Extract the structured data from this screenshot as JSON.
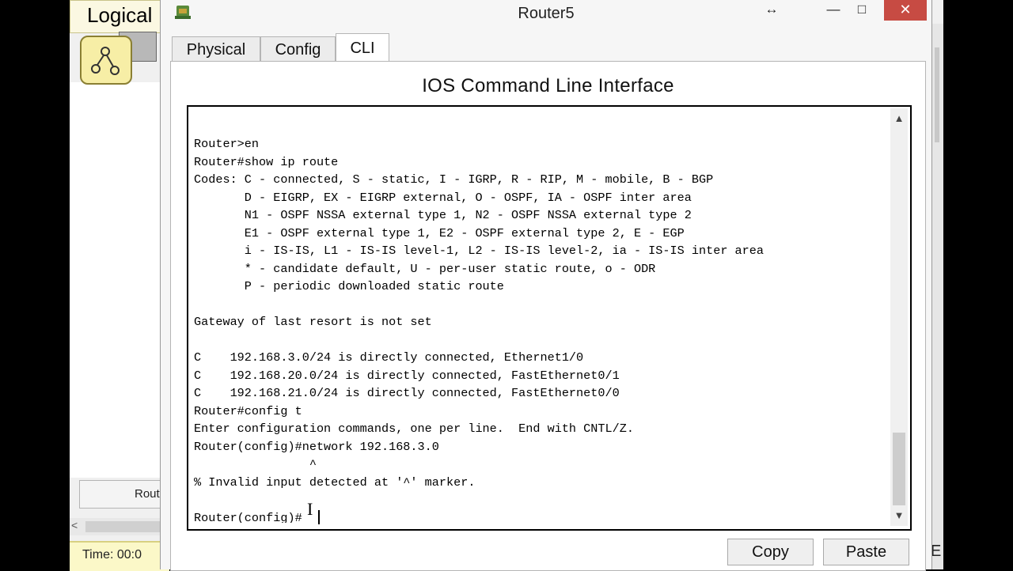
{
  "background": {
    "logical_label": "Logical",
    "device_button_label": "Rout",
    "time_label": "Time: 00:0",
    "right_edge_char": "E"
  },
  "window": {
    "title": "Router5",
    "controls": {
      "move": "↔",
      "minimize": "—",
      "maximize": "□",
      "close": "✕"
    }
  },
  "tabs": [
    {
      "label": "Physical",
      "active": false
    },
    {
      "label": "Config",
      "active": false
    },
    {
      "label": "CLI",
      "active": true
    }
  ],
  "cli": {
    "heading": "IOS Command Line Interface",
    "lines": [
      "Router>en",
      "Router#show ip route",
      "Codes: C - connected, S - static, I - IGRP, R - RIP, M - mobile, B - BGP",
      "       D - EIGRP, EX - EIGRP external, O - OSPF, IA - OSPF inter area",
      "       N1 - OSPF NSSA external type 1, N2 - OSPF NSSA external type 2",
      "       E1 - OSPF external type 1, E2 - OSPF external type 2, E - EGP",
      "       i - IS-IS, L1 - IS-IS level-1, L2 - IS-IS level-2, ia - IS-IS inter area",
      "       * - candidate default, U - per-user static route, o - ODR",
      "       P - periodic downloaded static route",
      "",
      "Gateway of last resort is not set",
      "",
      "C    192.168.3.0/24 is directly connected, Ethernet1/0",
      "C    192.168.20.0/24 is directly connected, FastEthernet0/1",
      "C    192.168.21.0/24 is directly connected, FastEthernet0/0",
      "Router#config t",
      "Enter configuration commands, one per line.  End with CNTL/Z.",
      "Router(config)#network 192.168.3.0",
      "                ^",
      "% Invalid input detected at '^' marker.",
      "",
      "Router(config)#"
    ],
    "scroll_up": "▲",
    "scroll_down": "▼"
  },
  "buttons": {
    "copy": "Copy",
    "paste": "Paste"
  }
}
